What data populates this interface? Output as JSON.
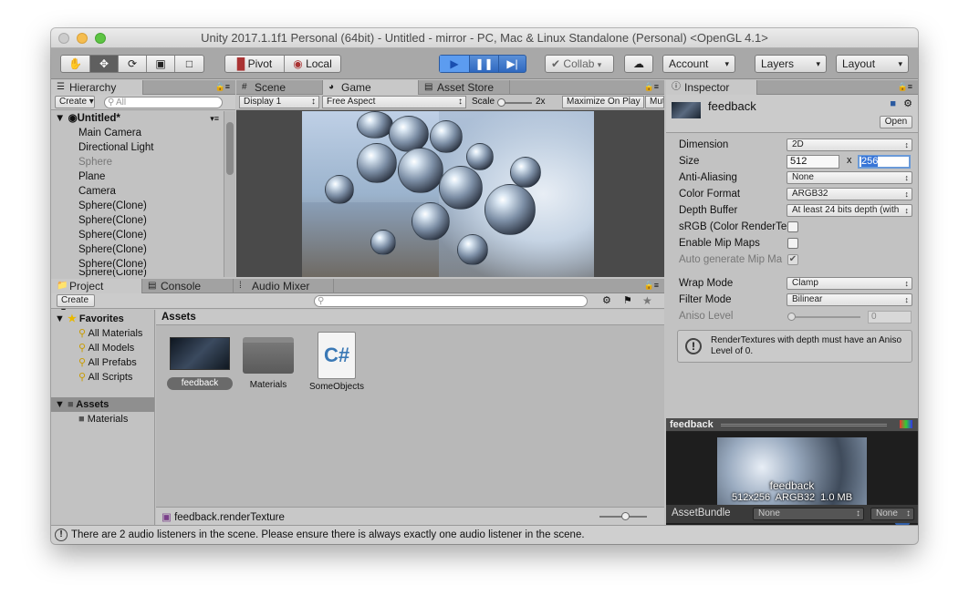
{
  "window": {
    "title": "Unity 2017.1.1f1 Personal (64bit) - Untitled - mirror - PC, Mac & Linux Standalone (Personal) <OpenGL 4.1>"
  },
  "toolbar": {
    "pivot": "Pivot",
    "local": "Local",
    "collab": "Collab",
    "account": "Account",
    "layers": "Layers",
    "layout": "Layout"
  },
  "hierarchy": {
    "tab": "Hierarchy",
    "create": "Create",
    "search_placeholder": "All",
    "scene": "Untitled*",
    "items": [
      "Main Camera",
      "Directional Light",
      "Sphere",
      "Plane",
      "Camera",
      "Sphere(Clone)",
      "Sphere(Clone)",
      "Sphere(Clone)",
      "Sphere(Clone)",
      "Sphere(Clone)",
      "Sphere(Clone)"
    ]
  },
  "center_tabs": {
    "scene": "Scene",
    "game": "Game",
    "asset_store": "Asset Store"
  },
  "game_bar": {
    "display": "Display 1",
    "aspect": "Free Aspect",
    "scale_label": "Scale",
    "scale_value": "2x",
    "maximize": "Maximize On Play",
    "mute": "Mut"
  },
  "bottom_tabs": {
    "project": "Project",
    "console": "Console",
    "audio_mixer": "Audio Mixer"
  },
  "project": {
    "create": "Create",
    "favorites_label": "Favorites",
    "favorites": [
      "All Materials",
      "All Models",
      "All Prefabs",
      "All Scripts"
    ],
    "assets_label": "Assets",
    "asset_folders": [
      "Materials"
    ],
    "breadcrumb": "Assets",
    "items": [
      {
        "name": "feedback",
        "type": "rendertexture"
      },
      {
        "name": "Materials",
        "type": "folder"
      },
      {
        "name": "SomeObjects",
        "type": "csharp"
      }
    ],
    "selected_path": "feedback.renderTexture"
  },
  "inspector": {
    "tab": "Inspector",
    "name": "feedback",
    "open": "Open",
    "fields": [
      {
        "label": "Dimension",
        "kind": "dropdown",
        "value": "2D"
      },
      {
        "label": "Size",
        "kind": "size",
        "w": "512",
        "h": "256",
        "sep": "x"
      },
      {
        "label": "Anti-Aliasing",
        "kind": "dropdown",
        "value": "None"
      },
      {
        "label": "Color Format",
        "kind": "dropdown",
        "value": "ARGB32"
      },
      {
        "label": "Depth Buffer",
        "kind": "dropdown",
        "value": "At least 24 bits depth (with"
      },
      {
        "label": "sRGB (Color RenderTe",
        "kind": "checkbox",
        "value": false
      },
      {
        "label": "Enable Mip Maps",
        "kind": "checkbox",
        "value": false
      },
      {
        "label": "Auto generate Mip Ma",
        "kind": "checkbox",
        "value": true,
        "disabled": true
      },
      {
        "label": "Wrap Mode",
        "kind": "dropdown",
        "value": "Clamp"
      },
      {
        "label": "Filter Mode",
        "kind": "dropdown",
        "value": "Bilinear"
      },
      {
        "label": "Aniso Level",
        "kind": "slider",
        "value": "0",
        "disabled": true
      }
    ],
    "warning": "RenderTextures with depth must have an Aniso Level of 0.",
    "preview_title": "feedback",
    "preview_name": "feedback",
    "preview_info": "512x256  ARGB32  1.0 MB",
    "assetbundle_label": "AssetBundle",
    "assetbundle_value": "None",
    "assetbundle_variant": "None"
  },
  "status": {
    "message": "There are 2 audio listeners in the scene. Please ensure there is always exactly one audio listener in the scene."
  }
}
